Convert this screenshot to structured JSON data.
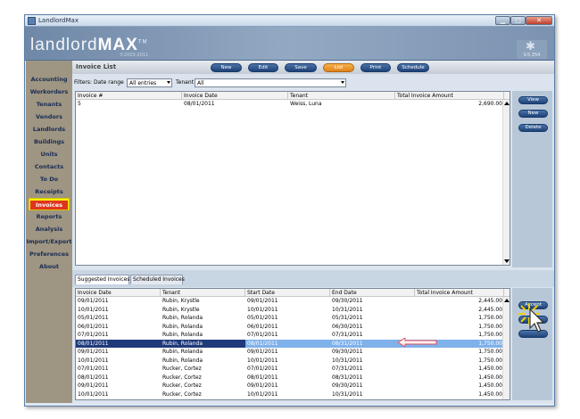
{
  "window": {
    "title": "LandlordMax"
  },
  "banner": {
    "logo_light": "landlord",
    "logo_bold": "MAX",
    "logo_tm": "TM",
    "logo_sub": "©2003-2011",
    "version": "V.5.354"
  },
  "sidebar": {
    "items": [
      {
        "label": "Accounting"
      },
      {
        "label": "Workorders"
      },
      {
        "label": "Tenants"
      },
      {
        "label": "Vendors"
      },
      {
        "label": "Landlords"
      },
      {
        "label": "Buildings"
      },
      {
        "label": "Units"
      },
      {
        "label": "Contacts"
      },
      {
        "label": "To Do"
      },
      {
        "label": "Receipts"
      },
      {
        "label": "Invoices"
      },
      {
        "label": "Reports"
      },
      {
        "label": "Analysis"
      },
      {
        "label": "Import/Export"
      },
      {
        "label": "Preferences"
      },
      {
        "label": "About"
      }
    ],
    "active": "Invoices"
  },
  "page": {
    "title": "Invoice List"
  },
  "toolbar": {
    "new": "New",
    "edit": "Edit",
    "save": "Save",
    "list": "List",
    "print": "Print",
    "schedule": "Schedule"
  },
  "filters": {
    "label": "Filters:",
    "date_range_label": "Date range",
    "date_range_value": "All entries",
    "tenant_label": "Tenant",
    "tenant_value": "All"
  },
  "invoice_table": {
    "headers": [
      "Invoice #",
      "Invoice Date",
      "Tenant",
      "Total Invoice Amount"
    ],
    "rows": [
      [
        "5",
        "08/01/2011",
        "Weiss, Luna",
        "2,690.00"
      ]
    ]
  },
  "right_buttons": {
    "view": "View",
    "new": "New",
    "delete": "Delete"
  },
  "tabs": {
    "suggested": "Suggested Invoices",
    "scheduled": "Scheduled Invoices"
  },
  "suggested_table": {
    "headers": [
      "Invoice Date",
      "Tenant",
      "Start Date",
      "End Date",
      "Total Invoice Amount"
    ],
    "rows": [
      [
        "09/01/2011",
        "Rubin, Krystle",
        "09/01/2011",
        "09/30/2011",
        "2,445.00"
      ],
      [
        "10/01/2011",
        "Rubin, Krystle",
        "10/01/2011",
        "10/31/2011",
        "2,445.00"
      ],
      [
        "05/01/2011",
        "Rubin, Rolanda",
        "05/01/2011",
        "05/31/2011",
        "1,750.00"
      ],
      [
        "06/01/2011",
        "Rubin, Rolanda",
        "06/01/2011",
        "06/30/2011",
        "1,750.00"
      ],
      [
        "07/01/2011",
        "Rubin, Rolanda",
        "07/01/2011",
        "07/31/2011",
        "1,750.00"
      ],
      [
        "08/01/2011",
        "Rubin, Rolanda",
        "08/01/2011",
        "08/31/2011",
        "1,750.00"
      ],
      [
        "09/01/2011",
        "Rubin, Rolanda",
        "09/01/2011",
        "09/30/2011",
        "1,750.00"
      ],
      [
        "10/01/2011",
        "Rubin, Rolanda",
        "10/01/2011",
        "10/31/2011",
        "1,750.00"
      ],
      [
        "07/01/2011",
        "Rucker, Cortez",
        "07/01/2011",
        "07/31/2011",
        "1,450.00"
      ],
      [
        "08/01/2011",
        "Rucker, Cortez",
        "08/01/2011",
        "08/31/2011",
        "1,450.00"
      ],
      [
        "09/01/2011",
        "Rucker, Cortez",
        "09/01/2011",
        "09/30/2011",
        "1,450.00"
      ],
      [
        "10/01/2011",
        "Rucker, Cortez",
        "10/01/2011",
        "10/31/2011",
        "1,450.00"
      ]
    ],
    "selected_index": 5
  },
  "accept_button": {
    "label": "Accept"
  },
  "colors": {
    "accent": "#1e4278",
    "active_item": "#e0341f",
    "highlight_row": "#1f3a7a",
    "list_button": "#f0a03a"
  }
}
